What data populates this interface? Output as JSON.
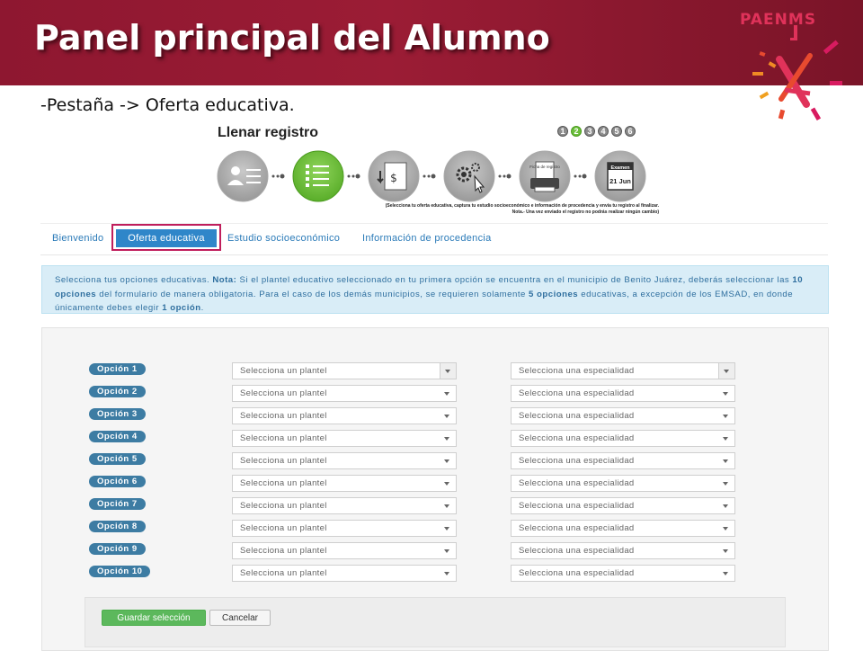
{
  "slide": {
    "title": "Panel principal del Alumno",
    "brand": "PAENMS",
    "subtitle": "-Pestaña -> Oferta educativa."
  },
  "wizard": {
    "title": "Llenar registro",
    "steps": [
      "1",
      "2",
      "3",
      "4",
      "5",
      "6"
    ],
    "active_step": "2",
    "icons": [
      {
        "name": "person-list-icon",
        "label": ""
      },
      {
        "name": "checklist-icon",
        "label": ""
      },
      {
        "name": "payment-document-icon",
        "label": "$"
      },
      {
        "name": "gears-cursor-icon",
        "label": ""
      },
      {
        "name": "printer-icon",
        "label": "Ficha de registro"
      },
      {
        "name": "calendar-icon",
        "label": "Examen 21 Jun"
      }
    ],
    "caption_line1": "(Selecciona tu oferta educativa, captura tu estudio socioeconómico e información de procedencia y envía tu registro al finalizar.",
    "caption_line2": "Nota.- Una vez enviado el registro no podrás realizar ningún cambio)"
  },
  "tabs": {
    "items": [
      "Bienvenido",
      "Oferta educativa",
      "Estudio socioeconómico",
      "Información de procedencia"
    ],
    "active": "Oferta educativa"
  },
  "note": {
    "p1": "Selecciona tus opciones educativas. ",
    "b1": "Nota:",
    "p2": " Si el plantel educativo seleccionado en tu primera opción se encuentra en el municipio de Benito Juárez, deberás seleccionar las ",
    "b2": "10 opciones",
    "p3": " del formulario de manera obligatoria. Para el caso de los demás municipios, se requieren solamente ",
    "b3": "5 opciones",
    "p4": " educativas, a excepción de los EMSAD, en donde únicamente debes elegir ",
    "b4": "1 opción",
    "p5": "."
  },
  "form": {
    "plantel_placeholder": "Selecciona un plantel",
    "especialidad_placeholder": "Selecciona una especialidad",
    "options": [
      "Opción 1",
      "Opción 2",
      "Opción 3",
      "Opción 4",
      "Opción 5",
      "Opción 6",
      "Opción 7",
      "Opción 8",
      "Opción 9",
      "Opción 10"
    ]
  },
  "actions": {
    "save_label": "Guardar selección",
    "cancel_label": "Cancelar"
  },
  "colors": {
    "banner": "#8e1730",
    "tab_active": "#2f86c9",
    "highlight": "#c01e5c",
    "badge": "#3d7ca3",
    "note_bg": "#d9edf7",
    "save": "#5cb85c",
    "wizard_active": "#6bbf3b"
  }
}
